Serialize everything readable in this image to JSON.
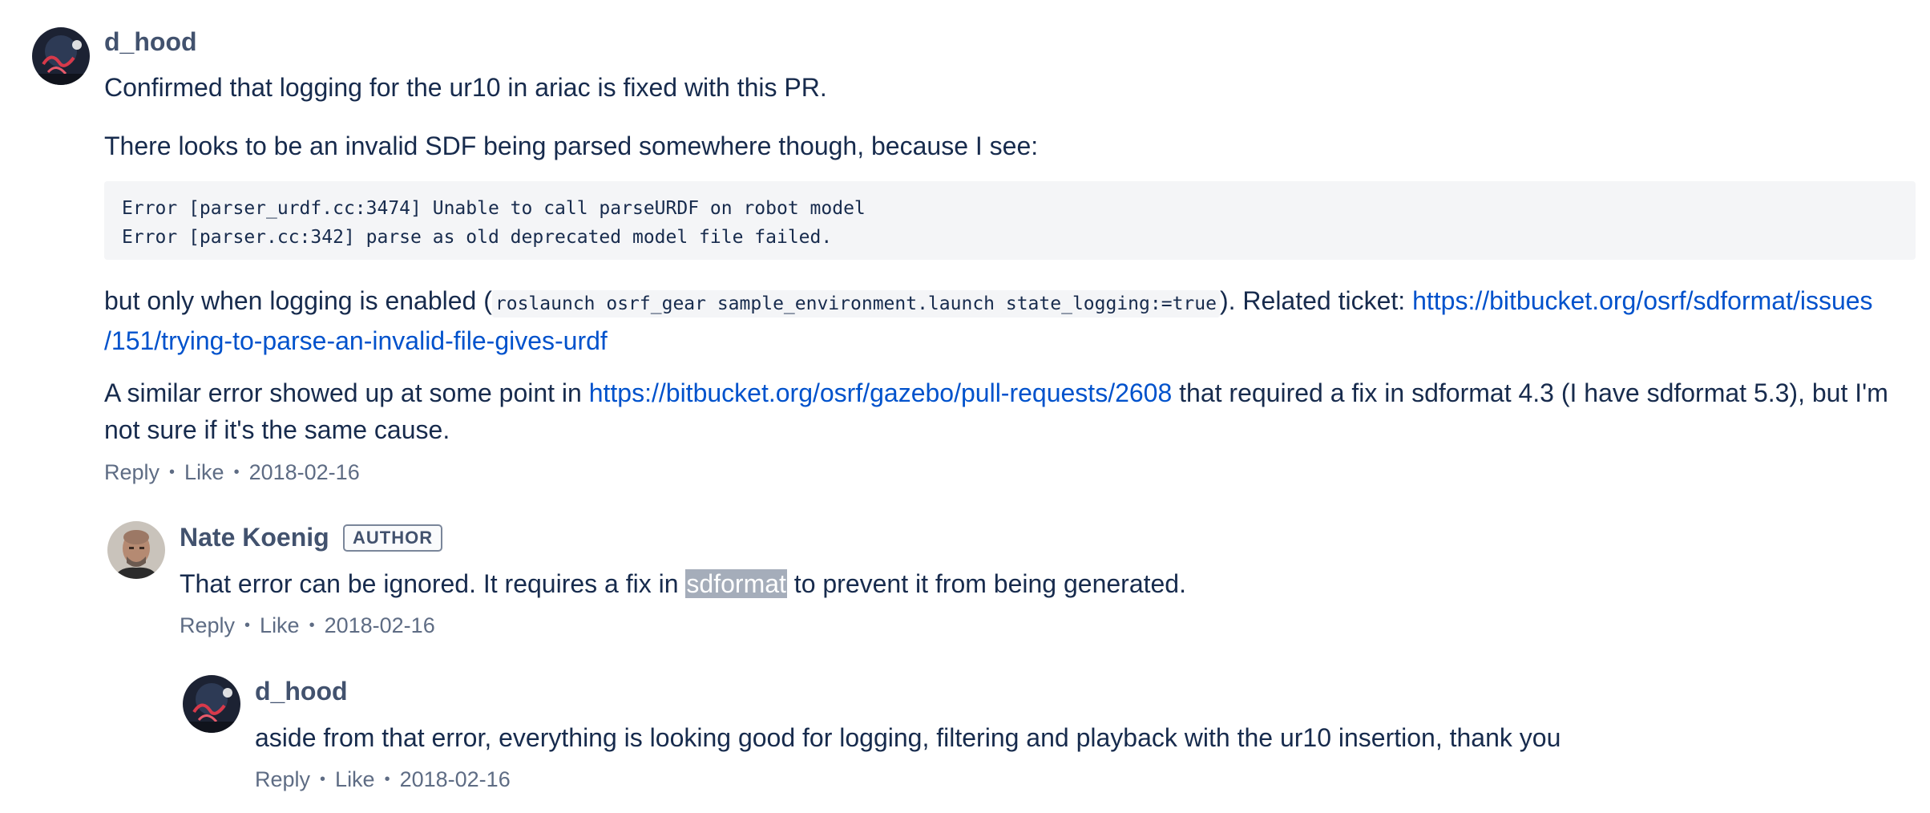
{
  "comment1": {
    "author": "d_hood",
    "paragraph1": "Confirmed that logging for the ur10 in ariac is fixed with this PR.",
    "paragraph2": "There looks to be an invalid SDF being parsed somewhere though, because I see:",
    "code_lines": [
      "Error [parser_urdf.cc:3474] Unable to call parseURDF on robot model",
      "Error [parser.cc:342] parse as old deprecated model file failed."
    ],
    "paragraph3_prefix": "but only when logging is enabled (",
    "paragraph3_code": "roslaunch osrf_gear sample_environment.launch state_logging:=true",
    "paragraph3_mid": "). Related ticket: ",
    "paragraph3_link_line1": "https://bitbucket.org/osrf/sdformat/issues",
    "paragraph3_link_line2": "/151/trying-to-parse-an-invalid-file-gives-urdf",
    "paragraph4_prefix": "A similar error showed up at some point in ",
    "paragraph4_link": "https://bitbucket.org/osrf/gazebo/pull-requests/2608",
    "paragraph4_suffix": " that required a fix in sdformat 4.3 (I have sdformat 5.3), but I'm not sure if it's the same cause.",
    "actions": {
      "reply": "Reply",
      "like": "Like",
      "date": "2018-02-16"
    }
  },
  "comment2": {
    "author": "Nate Koenig",
    "badge": "AUTHOR",
    "text_prefix": "That error can be ignored. It requires a fix in ",
    "text_highlight": "sdformat",
    "text_suffix": " to prevent it from being generated.",
    "actions": {
      "reply": "Reply",
      "like": "Like",
      "date": "2018-02-16"
    }
  },
  "comment3": {
    "author": "d_hood",
    "text": "aside from that error, everything is looking good for logging, filtering and playback with the ur10 insertion, thank you",
    "actions": {
      "reply": "Reply",
      "like": "Like",
      "date": "2018-02-16"
    }
  },
  "separator_dot": "•"
}
